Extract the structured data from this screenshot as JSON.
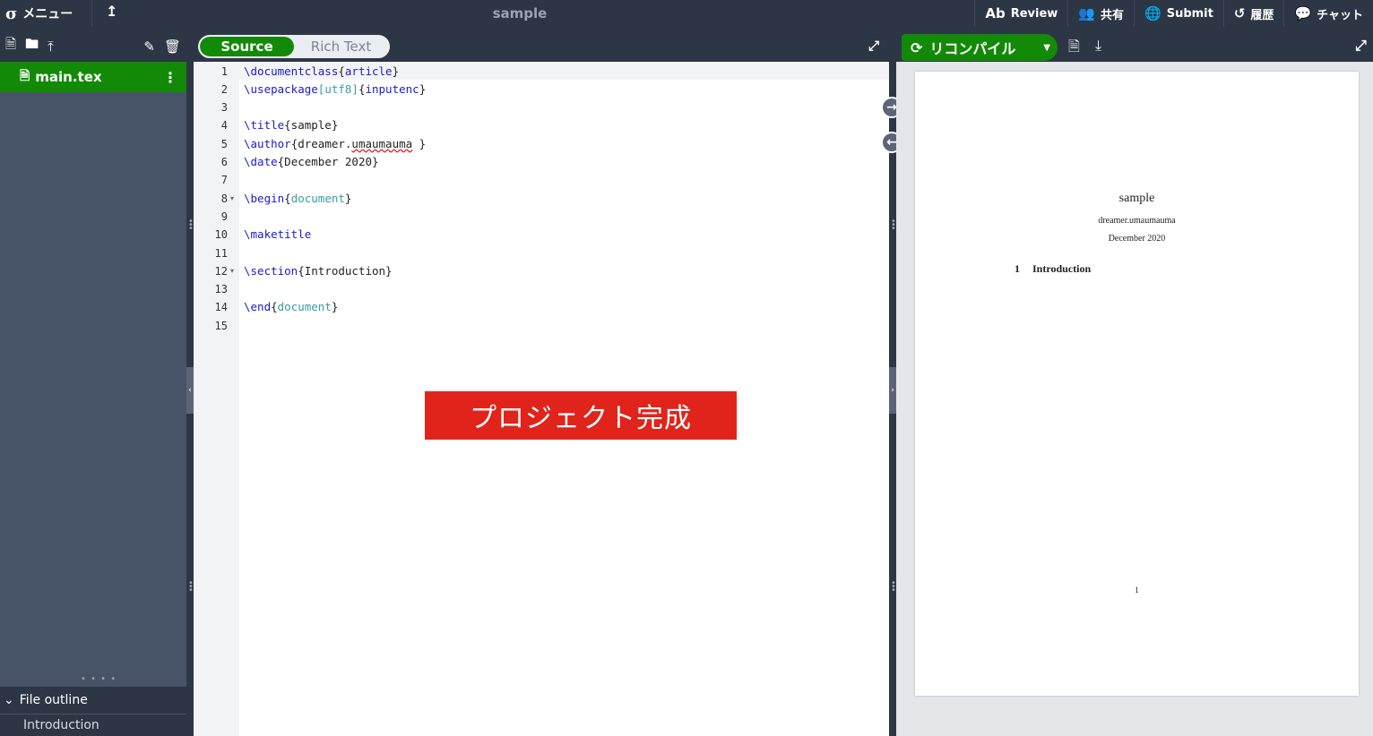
{
  "topbar": {
    "logo": "σ",
    "menu_label": "メニュー",
    "up_icon": "↥",
    "project_title": "sample",
    "actions": [
      {
        "icon": "review-icon",
        "glyph": "Ab",
        "label": "Review"
      },
      {
        "icon": "users-icon",
        "glyph": "👥",
        "label": "共有"
      },
      {
        "icon": "globe-icon",
        "glyph": "🌐",
        "label": "Submit"
      },
      {
        "icon": "history-icon",
        "glyph": "↺",
        "label": "履歴"
      },
      {
        "icon": "chat-icon",
        "glyph": "💬",
        "label": "チャット"
      }
    ]
  },
  "sidebar": {
    "file": {
      "name": "main.tex"
    },
    "outline": {
      "header": "File outline",
      "items": [
        "Introduction"
      ]
    }
  },
  "editor": {
    "modes": {
      "source": "Source",
      "rich": "Rich Text"
    },
    "lines": [
      {
        "n": "1",
        "parts": [
          [
            "kw",
            "\\documentclass"
          ],
          [
            "t",
            "{"
          ],
          [
            "kw",
            "article"
          ],
          [
            "t",
            "}"
          ]
        ]
      },
      {
        "n": "2",
        "parts": [
          [
            "kw",
            "\\usepackage"
          ],
          [
            "arg",
            "[utf8]"
          ],
          [
            "t",
            "{"
          ],
          [
            "kw",
            "inputenc"
          ],
          [
            "t",
            "}"
          ]
        ]
      },
      {
        "n": "3",
        "parts": []
      },
      {
        "n": "4",
        "parts": [
          [
            "kw",
            "\\title"
          ],
          [
            "t",
            "{sample}"
          ]
        ]
      },
      {
        "n": "5",
        "parts": [
          [
            "kw",
            "\\author"
          ],
          [
            "t",
            "{dreamer."
          ],
          [
            "sq",
            "umaumauma"
          ],
          [
            "t",
            " }"
          ]
        ]
      },
      {
        "n": "6",
        "parts": [
          [
            "kw",
            "\\date"
          ],
          [
            "t",
            "{December 2020}"
          ]
        ]
      },
      {
        "n": "7",
        "parts": []
      },
      {
        "n": "8",
        "parts": [
          [
            "kw",
            "\\begin"
          ],
          [
            "t",
            "{"
          ],
          [
            "arg",
            "document"
          ],
          [
            "t",
            "}"
          ]
        ],
        "fold": true
      },
      {
        "n": "9",
        "parts": []
      },
      {
        "n": "10",
        "parts": [
          [
            "kw",
            "\\maketitle"
          ]
        ]
      },
      {
        "n": "11",
        "parts": []
      },
      {
        "n": "12",
        "parts": [
          [
            "kw",
            "\\section"
          ],
          [
            "t",
            "{Introduction}"
          ]
        ],
        "fold": true
      },
      {
        "n": "13",
        "parts": []
      },
      {
        "n": "14",
        "parts": [
          [
            "kw",
            "\\end"
          ],
          [
            "t",
            "{"
          ],
          [
            "arg",
            "document"
          ],
          [
            "t",
            "}"
          ]
        ]
      },
      {
        "n": "15",
        "parts": []
      }
    ],
    "banner": "プロジェクト完成"
  },
  "pdf": {
    "recompile_label": "リコンパイル",
    "page": {
      "title": "sample",
      "author": "dreamer.umaumauma",
      "date": "December 2020",
      "section_num": "1",
      "section_title": "Introduction",
      "page_number": "1"
    }
  },
  "colors": {
    "accent": "#138a07",
    "chrome": "#2c3645",
    "banner": "#e0241b"
  }
}
